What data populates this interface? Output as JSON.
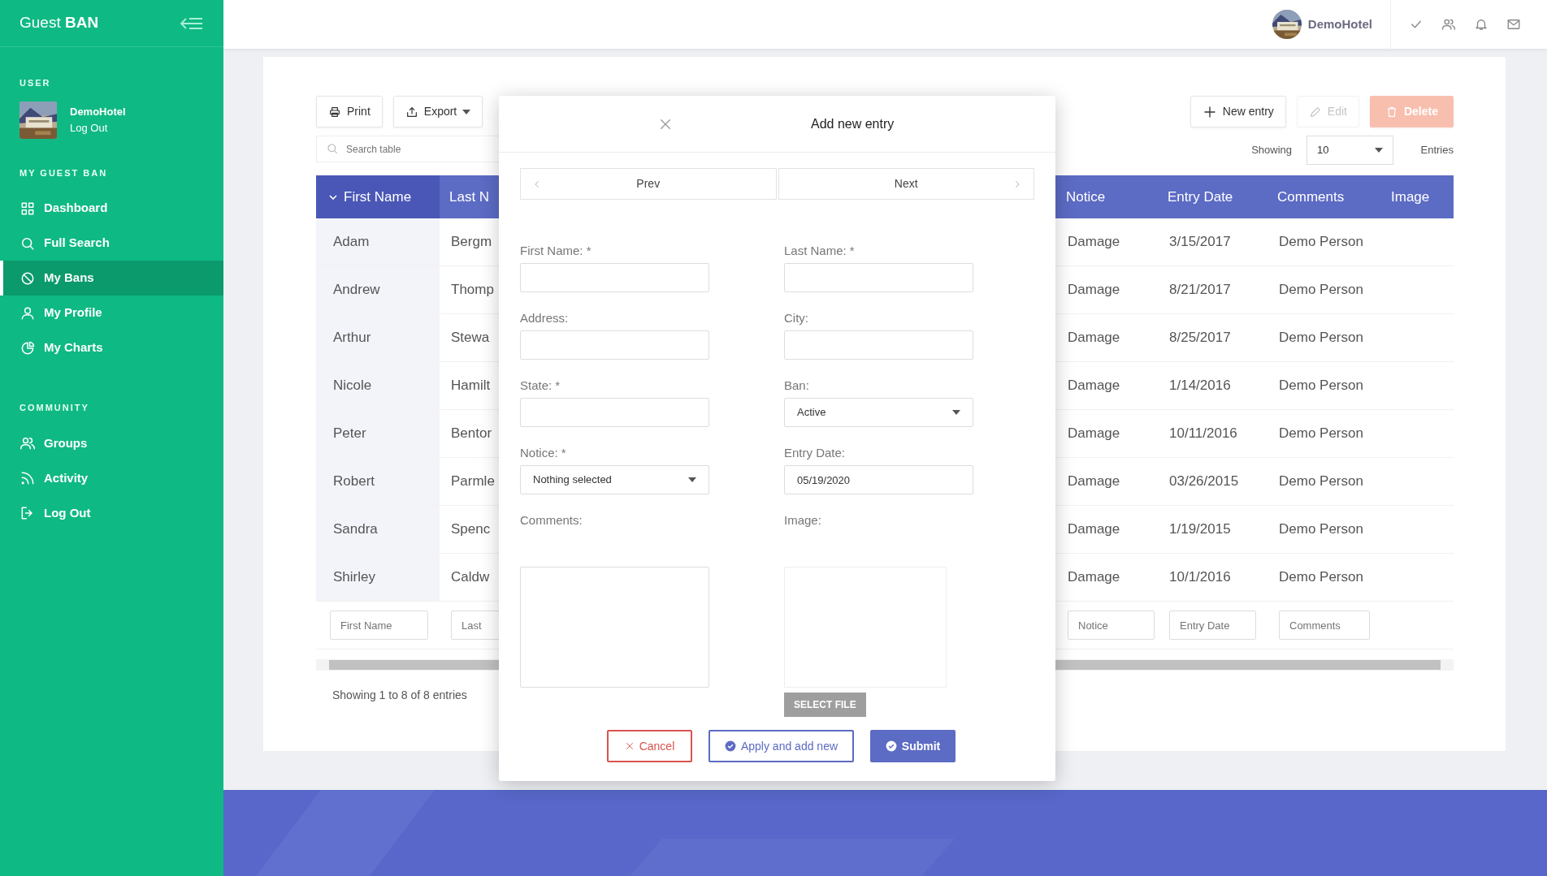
{
  "sidebar": {
    "brand": "Guest **BAN**",
    "user_heading": "USER",
    "user": {
      "name": "DemoHotel",
      "link": "Log Out"
    },
    "groups": [
      {
        "heading": "MY GUEST BAN",
        "items": [
          {
            "label": "Dashboard",
            "selected": false
          },
          {
            "label": "Full Search",
            "selected": false
          },
          {
            "label": "My Bans",
            "selected": true
          },
          {
            "label": "My Profile",
            "selected": false
          },
          {
            "label": "My Charts",
            "selected": false
          }
        ]
      },
      {
        "heading": "COMMUNITY",
        "items": [
          {
            "label": "Groups",
            "selected": false
          },
          {
            "label": "Activity",
            "selected": false
          },
          {
            "label": "Log Out",
            "selected": false
          }
        ]
      }
    ]
  },
  "topbar": {
    "user_name": "DemoHotel"
  },
  "toolbar": {
    "print": "Print",
    "export": "Export",
    "search": {
      "placeholder": "Search table"
    },
    "new_entry": "New entry",
    "edit": {
      "label": "Edit",
      "disabled": true
    },
    "delete": {
      "label": "Delete",
      "disabled": true
    },
    "showing_label": "Showing",
    "page_size": "10",
    "entries_label": "Entries"
  },
  "table": {
    "columns": [
      {
        "label": "First Name",
        "sorted": true
      },
      {
        "label": "Last N",
        "sorted": false
      },
      {
        "label": "Notice",
        "sorted": false
      },
      {
        "label": "Entry Date",
        "sorted": false
      },
      {
        "label": "Comments",
        "sorted": false
      },
      {
        "label": "Image",
        "sorted": false
      }
    ],
    "rows": [
      [
        "Adam",
        "Bergm",
        "Damage",
        "3/15/2017",
        "Demo Person"
      ],
      [
        "Andrew",
        "Thomp",
        "Damage",
        "8/21/2017",
        "Demo Person"
      ],
      [
        "Arthur",
        "Stewa",
        "Damage",
        "8/25/2017",
        "Demo Person"
      ],
      [
        "Nicole",
        "Hamilt",
        "Damage",
        "1/14/2016",
        "Demo Person"
      ],
      [
        "Peter",
        "Bentor",
        "Damage",
        "10/11/2016",
        "Demo Person"
      ],
      [
        "Robert",
        "Parmle",
        "Damage",
        "03/26/2015",
        "Demo Person"
      ],
      [
        "Sandra",
        "Spenc",
        "Damage",
        "1/19/2015",
        "Demo Person"
      ],
      [
        "Shirley",
        "Caldw",
        "Damage",
        "10/1/2016",
        "Demo Person"
      ]
    ],
    "filters": [
      {
        "placeholder": "First Name"
      },
      {
        "placeholder": "Last"
      },
      {
        "placeholder": "Notice"
      },
      {
        "placeholder": "Entry Date"
      },
      {
        "placeholder": "Comments"
      }
    ],
    "status": "Showing 1 to 8 of 8 entries"
  },
  "modal": {
    "title": "Add new entry",
    "prev": "Prev",
    "next": "Next",
    "fields": [
      {
        "label": "First Name: *",
        "kind": "text"
      },
      {
        "label": "Last Name: *",
        "kind": "text"
      },
      {
        "label": "Address:",
        "kind": "text"
      },
      {
        "label": "City:",
        "kind": "text"
      },
      {
        "label": "State: *",
        "kind": "text"
      },
      {
        "label": "Ban:",
        "kind": "select",
        "value": "Active"
      },
      {
        "label": "Notice: *",
        "kind": "select",
        "value": "Nothing selected"
      },
      {
        "label": "Entry Date:",
        "kind": "text",
        "value": "05/19/2020"
      },
      {
        "label": "Comments:",
        "kind": "textarea"
      },
      {
        "label": "Image:",
        "kind": "file",
        "button": "SELECT FILE"
      }
    ],
    "buttons": [
      {
        "label": "Cancel",
        "kind": "cancel"
      },
      {
        "label": "Apply and add new",
        "kind": "apply"
      },
      {
        "label": "Submit",
        "kind": "submit"
      }
    ]
  }
}
